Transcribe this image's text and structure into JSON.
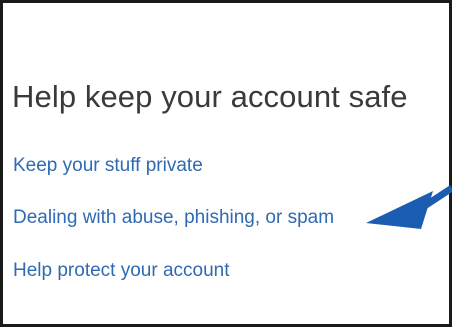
{
  "section": {
    "heading": "Help keep your account safe",
    "links": [
      {
        "label": "Keep your stuff private"
      },
      {
        "label": "Dealing with abuse, phishing, or spam"
      },
      {
        "label": "Help protect your account"
      }
    ]
  },
  "annotation": {
    "arrow_icon": "pointer-arrow-icon",
    "arrow_color": "#1b5db0"
  },
  "colors": {
    "link": "#2f6ab3",
    "heading": "#3a3a3a",
    "border": "#1a1a1a"
  }
}
